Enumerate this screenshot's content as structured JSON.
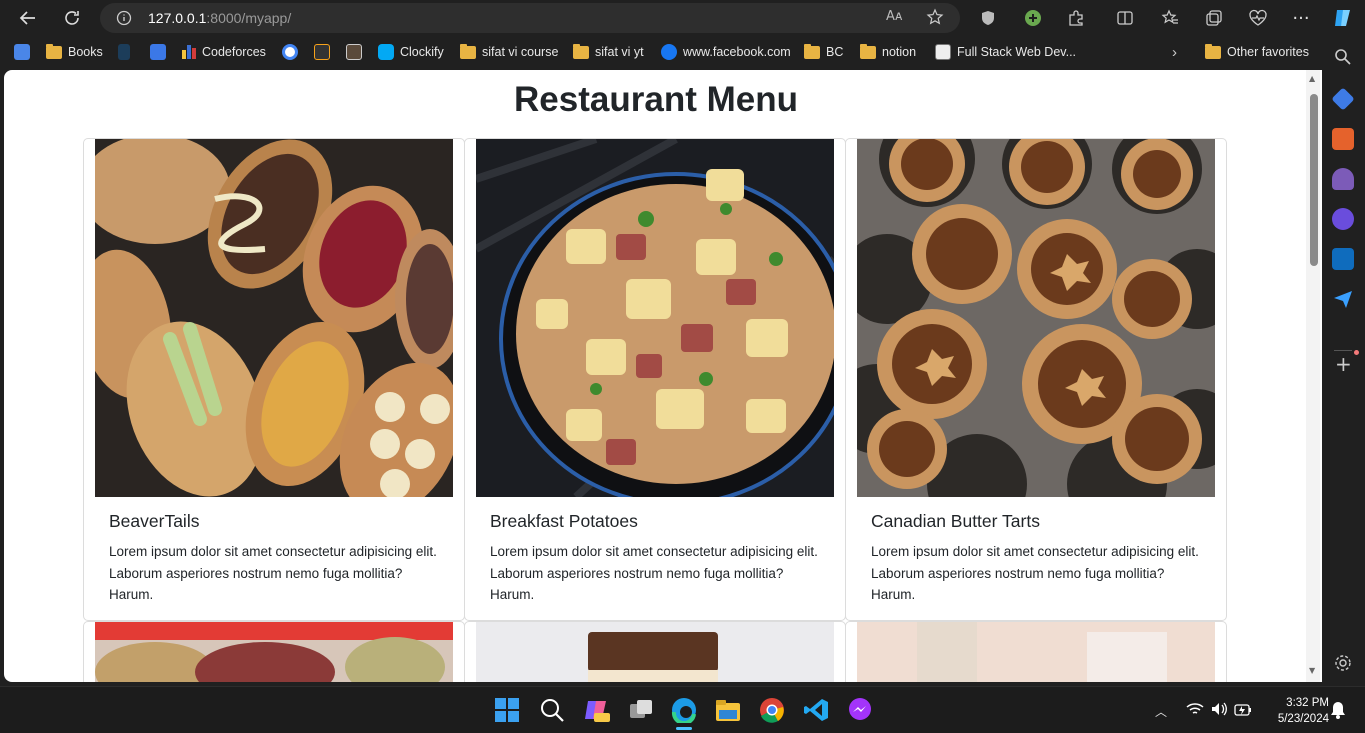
{
  "browser": {
    "url_host": "127.0.0.1",
    "url_rest": ":8000/myapp/",
    "read_aloud_label": "Aᴀ"
  },
  "bookmarks": [
    {
      "label": "Books",
      "icon": "folder-icon"
    },
    {
      "label": "Codeforces",
      "icon": "codeforces-icon"
    },
    {
      "label": "Clockify",
      "icon": "clockify-icon"
    },
    {
      "label": "sifat vi course",
      "icon": "folder-icon"
    },
    {
      "label": "sifat vi yt",
      "icon": "folder-icon"
    },
    {
      "label": "www.facebook.com",
      "icon": "facebook-icon"
    },
    {
      "label": "BC",
      "icon": "folder-icon"
    },
    {
      "label": "notion",
      "icon": "folder-icon"
    },
    {
      "label": "Full Stack Web Dev...",
      "icon": "site-icon"
    },
    {
      "label": "Other favorites",
      "icon": "folder-icon"
    }
  ],
  "page": {
    "title": "Restaurant Menu",
    "cards": [
      {
        "title": "BeaverTails",
        "text": "Lorem ipsum dolor sit amet consectetur adipisicing elit. Laborum asperiores nostrum nemo fuga mollitia? Harum.",
        "image": "beavertails-photo"
      },
      {
        "title": "Breakfast Potatoes",
        "text": "Lorem ipsum dolor sit amet consectetur adipisicing elit. Laborum asperiores nostrum nemo fuga mollitia? Harum.",
        "image": "breakfast-potatoes-photo"
      },
      {
        "title": "Canadian Butter Tarts",
        "text": "Lorem ipsum dolor sit amet consectetur adipisicing elit. Laborum asperiores nostrum nemo fuga mollitia? Harum.",
        "image": "butter-tarts-photo"
      }
    ]
  },
  "taskbar": {
    "time": "3:32 PM",
    "date": "5/23/2024"
  },
  "colors": {
    "accent": "#0078d4",
    "folder": "#e8b443",
    "text": "#212529"
  }
}
